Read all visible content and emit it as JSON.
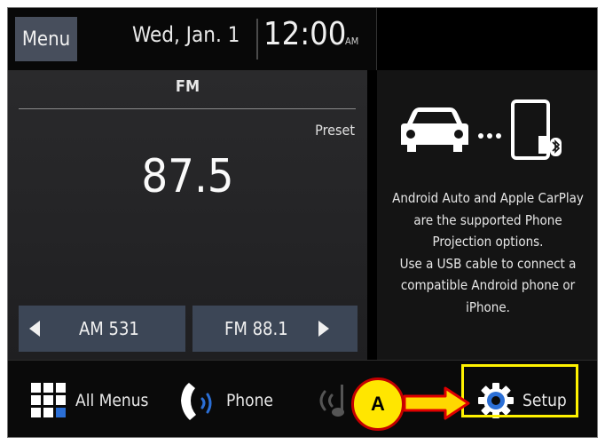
{
  "topbar": {
    "menu_label": "Menu",
    "date": "Wed, Jan. 1",
    "time": "12:00",
    "ampm": "AM"
  },
  "radio": {
    "band": "FM",
    "preset_label": "Preset",
    "frequency": "87.5",
    "prev_station": "AM 531",
    "next_station": "FM 88.1"
  },
  "projection": {
    "icons": [
      "car-icon",
      "ellipsis-icon",
      "phone-usb-bluetooth-icon"
    ],
    "message_lines": [
      "Android Auto and Apple CarPlay",
      "are the supported Phone",
      "Projection options.",
      "Use a USB cable to connect a",
      "compatible Android phone or",
      "iPhone."
    ]
  },
  "dock": {
    "all_menus_label": "All Menus",
    "phone_label": "Phone",
    "setup_label": "Setup",
    "icons": [
      "grid-icon",
      "phone-icon",
      "media-icon",
      "gear-icon"
    ]
  },
  "annotation": {
    "callout_label": "A",
    "highlight_color": "#fff200",
    "arrow_color": "#e00000",
    "callout_fill": "#ffe600"
  },
  "colors": {
    "tune_button": "#3c4656",
    "menu_button": "#474e5c",
    "accent_blue": "#2b6fd6"
  }
}
